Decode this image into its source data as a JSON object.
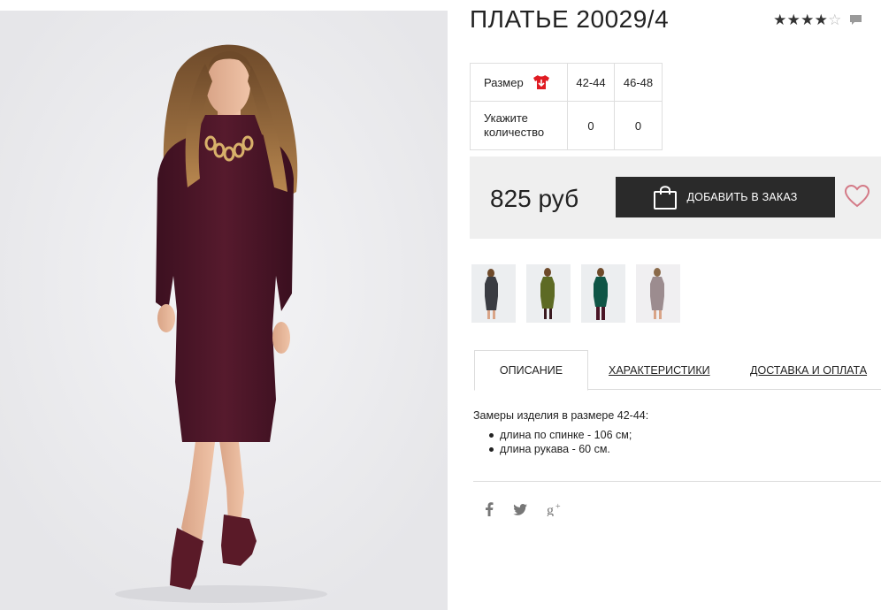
{
  "product": {
    "title": "ПЛАТЬЕ 20029/4",
    "rating": {
      "value": 4,
      "max": 5
    },
    "image_alt_icon": "product-photo"
  },
  "sizes": {
    "size_label": "Размер",
    "size_icon": "size-chart-icon",
    "quantity_label_line1": "Укажите",
    "quantity_label_line2": "количество",
    "columns": [
      {
        "size": "42-44",
        "quantity": "0"
      },
      {
        "size": "46-48",
        "quantity": "0"
      }
    ]
  },
  "purchase": {
    "price": "825 руб",
    "add_button_label": "ДОБАВИТЬ В ЗАКАЗ",
    "bag_icon": "shopping-bag-icon",
    "wishlist_icon": "heart-icon"
  },
  "colors": {
    "thumbs": [
      {
        "dress_color": "#3a3c42",
        "icon": "thumbnail"
      },
      {
        "dress_color": "#5d6a24",
        "icon": "thumbnail"
      },
      {
        "dress_color": "#0f5546",
        "icon": "thumbnail"
      },
      {
        "dress_color": "#9c8c8f",
        "icon": "thumbnail"
      }
    ]
  },
  "tabs": [
    {
      "label": "ОПИСАНИЕ",
      "active": true
    },
    {
      "label": "ХАРАКТЕРИСТИКИ",
      "active": false
    },
    {
      "label": "ДОСТАВКА И ОПЛАТА",
      "active": false
    }
  ],
  "description": {
    "intro": "Замеры изделия в размере 42-44:",
    "items": [
      "длина по спинке - 106 см;",
      "длина рукава - 60 см."
    ]
  },
  "social": [
    {
      "icon": "facebook-icon",
      "glyph": "f"
    },
    {
      "icon": "twitter-icon",
      "glyph": ""
    },
    {
      "icon": "google-plus-icon",
      "glyph": "g+"
    }
  ],
  "theme": {
    "accent_dark": "#2a2a2a",
    "heart_color": "#d47a87",
    "size_icon_color": "#e01b22",
    "dress_color": "#4a1526"
  }
}
